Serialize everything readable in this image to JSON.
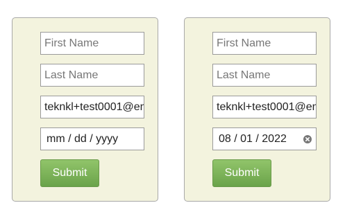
{
  "forms": [
    {
      "first_name": {
        "placeholder": "First Name",
        "value": ""
      },
      "last_name": {
        "placeholder": "Last Name",
        "value": ""
      },
      "email": {
        "value": "teknkl+test0001@em"
      },
      "date": {
        "display": "mm / dd / yyyy",
        "is_placeholder": true
      },
      "submit_label": "Submit"
    },
    {
      "first_name": {
        "placeholder": "First Name",
        "value": ""
      },
      "last_name": {
        "placeholder": "Last Name",
        "value": ""
      },
      "email": {
        "value": "teknkl+test0001@em"
      },
      "date": {
        "display": "08 / 01 / 2022",
        "is_placeholder": false,
        "clear_icon": "clear-circle-icon"
      },
      "submit_label": "Submit"
    }
  ],
  "colors": {
    "panel_bg": "#f3f3de",
    "button_top": "#91c46a",
    "button_bottom": "#6aa34a"
  }
}
